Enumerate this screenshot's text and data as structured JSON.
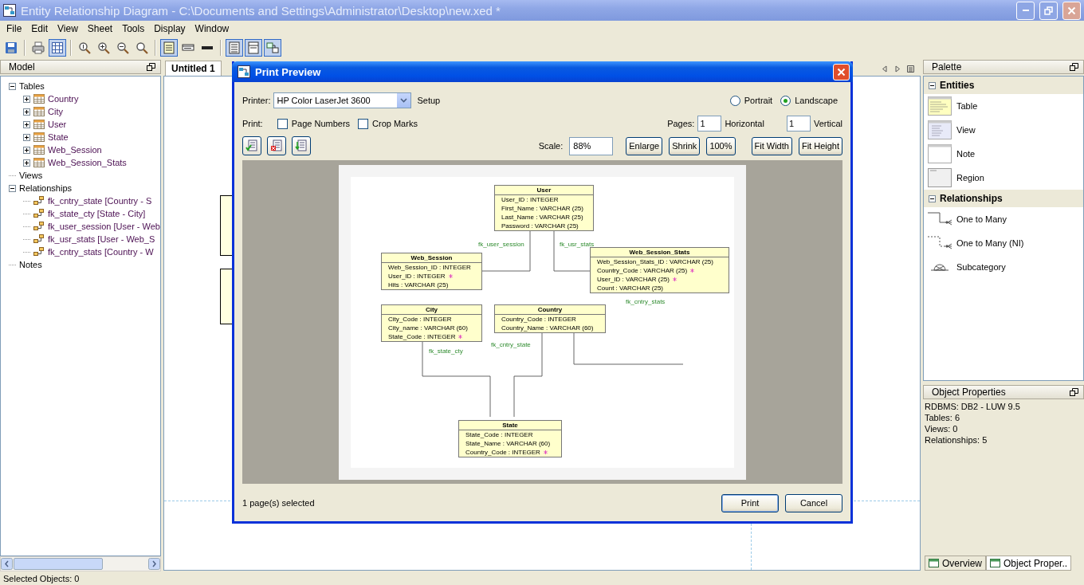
{
  "window": {
    "title": "Entity Relationship Diagram - C:\\Documents and Settings\\Administrator\\Desktop\\new.xed *"
  },
  "menu": [
    "File",
    "Edit",
    "View",
    "Sheet",
    "Tools",
    "Display",
    "Window"
  ],
  "toolbar": [
    [
      {
        "pressed": false
      }
    ],
    [
      {
        "pressed": false
      },
      {
        "pressed": true
      }
    ],
    [
      {
        "pressed": false
      },
      {
        "pressed": false
      },
      {
        "pressed": false
      },
      {
        "pressed": false
      }
    ],
    [
      {
        "pressed": true
      },
      {
        "pressed": false
      },
      {
        "pressed": false
      }
    ],
    [
      {
        "pressed": true
      },
      {
        "pressed": true
      },
      {
        "pressed": true
      }
    ]
  ],
  "model_panel": {
    "title": "Model",
    "tree": [
      {
        "label": "Tables",
        "kind": "folder",
        "expanded": true,
        "children": [
          {
            "label": "Country",
            "kind": "table",
            "expanded": false
          },
          {
            "label": "City",
            "kind": "table",
            "expanded": false
          },
          {
            "label": "User",
            "kind": "table",
            "expanded": false
          },
          {
            "label": "State",
            "kind": "table",
            "expanded": false
          },
          {
            "label": "Web_Session",
            "kind": "table",
            "expanded": false
          },
          {
            "label": "Web_Session_Stats",
            "kind": "table",
            "expanded": false
          }
        ]
      },
      {
        "label": "Views",
        "kind": "folder"
      },
      {
        "label": "Relationships",
        "kind": "folder",
        "expanded": true,
        "children": [
          {
            "label": "fk_cntry_state [Country - S",
            "kind": "relationship"
          },
          {
            "label": "fk_state_cty [State - City]",
            "kind": "relationship"
          },
          {
            "label": "fk_user_session [User - Web",
            "kind": "relationship"
          },
          {
            "label": "fk_usr_stats [User - Web_S",
            "kind": "relationship"
          },
          {
            "label": "fk_cntry_stats [Country - W",
            "kind": "relationship"
          }
        ]
      },
      {
        "label": "Notes",
        "kind": "folder"
      }
    ]
  },
  "document_tabs": [
    {
      "label": "Untitled 1",
      "selected": true
    }
  ],
  "print_preview": {
    "title": "Print Preview",
    "printer_label": "Printer:",
    "printer": "HP Color LaserJet 3600",
    "setup": "Setup",
    "orientations": [
      {
        "label": "Portrait",
        "selected": false
      },
      {
        "label": "Landscape",
        "selected": true
      }
    ],
    "print_label": "Print:",
    "options": [
      {
        "label": "Page Numbers",
        "checked": false
      },
      {
        "label": "Crop Marks",
        "checked": false
      }
    ],
    "pages_label": "Pages:",
    "pages": [
      {
        "value": "1",
        "label": "Horizontal"
      },
      {
        "value": "1",
        "label": "Vertical"
      }
    ],
    "scale_label": "Scale:",
    "scale": "88%",
    "zoom_buttons": [
      "Enlarge",
      "Shrink",
      "100%"
    ],
    "fit_buttons": [
      "Fit Width",
      "Fit Height"
    ],
    "diagram": {
      "entities": [
        {
          "name": "User",
          "columns": [
            {
              "text": "User_ID : INTEGER",
              "fk": false
            },
            {
              "text": "First_Name : VARCHAR (25)",
              "fk": false
            },
            {
              "text": "Last_Name : VARCHAR (25)",
              "fk": false
            },
            {
              "text": "Password : VARCHAR (25)",
              "fk": false
            }
          ]
        },
        {
          "name": "Web_Session",
          "columns": [
            {
              "text": "Web_Session_ID : INTEGER",
              "fk": false
            },
            {
              "text": "User_ID : INTEGER",
              "fk": true
            },
            {
              "text": "Hits : VARCHAR (25)",
              "fk": false
            }
          ]
        },
        {
          "name": "Web_Session_Stats",
          "columns": [
            {
              "text": "Web_Session_Stats_ID : VARCHAR (25)",
              "fk": false
            },
            {
              "text": "Country_Code : VARCHAR (25)",
              "fk": true
            },
            {
              "text": "User_ID : VARCHAR (25)",
              "fk": true
            },
            {
              "text": "Count : VARCHAR (25)",
              "fk": false
            }
          ]
        },
        {
          "name": "City",
          "columns": [
            {
              "text": "City_Code : INTEGER",
              "fk": false
            },
            {
              "text": "City_name : VARCHAR (60)",
              "fk": false
            },
            {
              "text": "State_Code : INTEGER",
              "fk": true
            }
          ]
        },
        {
          "name": "Country",
          "columns": [
            {
              "text": "Country_Code : INTEGER",
              "fk": false
            },
            {
              "text": "Country_Name : VARCHAR (60)",
              "fk": false
            }
          ]
        },
        {
          "name": "State",
          "columns": [
            {
              "text": "State_Code : INTEGER",
              "fk": false
            },
            {
              "text": "State_Name : VARCHAR (60)",
              "fk": false
            },
            {
              "text": "Country_Code : INTEGER",
              "fk": true
            }
          ]
        }
      ],
      "relationships": [
        {
          "name": "fk_user_session"
        },
        {
          "name": "fk_usr_stats"
        },
        {
          "name": "fk_cntry_stats"
        },
        {
          "name": "fk_state_cty"
        },
        {
          "name": "fk_cntry_state"
        }
      ]
    },
    "selection": "1 page(s) selected",
    "actions": [
      "Print",
      "Cancel"
    ]
  },
  "palette": {
    "title": "Palette",
    "sections": [
      {
        "title": "Entities",
        "expanded": true,
        "items": [
          {
            "label": "Table",
            "kind": "table"
          },
          {
            "label": "View",
            "kind": "view"
          },
          {
            "label": "Note",
            "kind": "note"
          },
          {
            "label": "Region",
            "kind": "region"
          }
        ]
      },
      {
        "title": "Relationships",
        "expanded": true,
        "items": [
          {
            "label": "One to Many",
            "kind": "one_to_many"
          },
          {
            "label": "One to Many (NI)",
            "kind": "one_to_many_ni"
          },
          {
            "label": "Subcategory",
            "kind": "subcategory"
          }
        ]
      }
    ]
  },
  "object_properties": {
    "title": "Object Properties",
    "lines": [
      "RDBMS: DB2 - LUW 9.5",
      "Tables: 6",
      "Views: 0",
      "Relationships: 5"
    ]
  },
  "side_tabs": [
    {
      "label": "Overview",
      "selected": false
    },
    {
      "label": "Object Proper..",
      "selected": true
    }
  ],
  "status_bar": "Selected Objects: 0"
}
